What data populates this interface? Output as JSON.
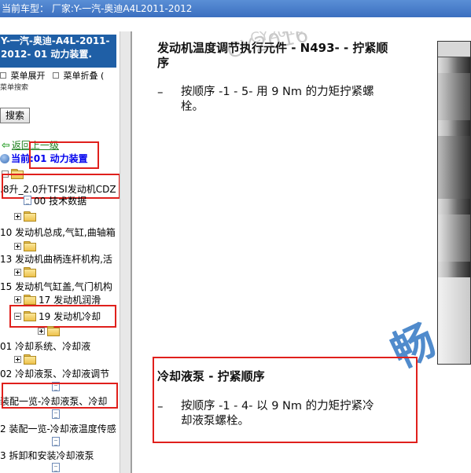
{
  "titlebar": {
    "text": "当前车型： 厂家:Y-一汽-奥迪A4L2011-2012"
  },
  "sidebar": {
    "header_line1": "Y-一汽-奥迪-A4L-2011-",
    "header_line2": "2012- 01 动力装置.",
    "menu_expand": "菜单展开",
    "menu_collapse": "菜单折叠 (",
    "search_hint": "菜单搜索",
    "search_button": "搜索",
    "back_label": "返回上一级",
    "current_label": "当前:01 动力装置",
    "tree": [
      {
        "label": "",
        "kind": "folder"
      },
      {
        "label": ".8升_2.0升TFSI发动机CDZ",
        "kind": "text"
      },
      {
        "label": "00 技术数据",
        "kind": "doc"
      },
      {
        "label": "",
        "kind": "folder-plus"
      },
      {
        "label": "10 发动机总成,气缸,曲轴箱",
        "kind": "text"
      },
      {
        "label": "",
        "kind": "folder-plus"
      },
      {
        "label": "13 发动机曲柄连杆机构,活",
        "kind": "text"
      },
      {
        "label": "",
        "kind": "folder-plus"
      },
      {
        "label": "15 发动机气缸盖,气门机构",
        "kind": "text"
      },
      {
        "label": "17 发动机润滑",
        "kind": "folder-plus"
      },
      {
        "label": "19 发动机冷却",
        "kind": "folder-minus"
      },
      {
        "label": "",
        "kind": "folder-plus"
      },
      {
        "label": "01 冷却系统、冷却液",
        "kind": "text"
      },
      {
        "label": "",
        "kind": "folder-plus"
      },
      {
        "label": "02 冷却液泵、冷却液调节",
        "kind": "text"
      },
      {
        "label": "",
        "kind": "doc"
      },
      {
        "label": " 装配一览-冷却液泵、冷却",
        "kind": "text"
      },
      {
        "label": "",
        "kind": "doc"
      },
      {
        "label": "2 装配一览-冷却液温度传感",
        "kind": "text"
      },
      {
        "label": "",
        "kind": "doc"
      },
      {
        "label": "3 拆卸和安装冷却液泵",
        "kind": "text"
      },
      {
        "label": "",
        "kind": "doc"
      }
    ]
  },
  "content": {
    "section1_title_line1": "发动机温度调节执行元件 - N493- - 拧紧顺",
    "section1_title_line2": "序",
    "section1_dash": "–",
    "section1_bullet_line1": "按顺序 -1 - 5- 用 9 Nm 的力矩拧紧螺",
    "section1_bullet_line2": "栓。",
    "section2_title": "冷却液泵 - 拧紧顺序",
    "section2_dash": "–",
    "section2_bullet_line1": "按顺序 -1 - 4- 以 9 Nm 的力矩拧紧冷",
    "section2_bullet_line2": "却液泵螺栓。",
    "watermark1": "CY2016",
    "watermark2": "CY2016",
    "brand_stamp": "畅"
  },
  "colors": {
    "titlebar": "#3b6fc0",
    "sidebar_header": "#1f5fa6",
    "highlight_box": "#e0201c",
    "current_label": "#0000ee",
    "back_link": "#208020"
  }
}
